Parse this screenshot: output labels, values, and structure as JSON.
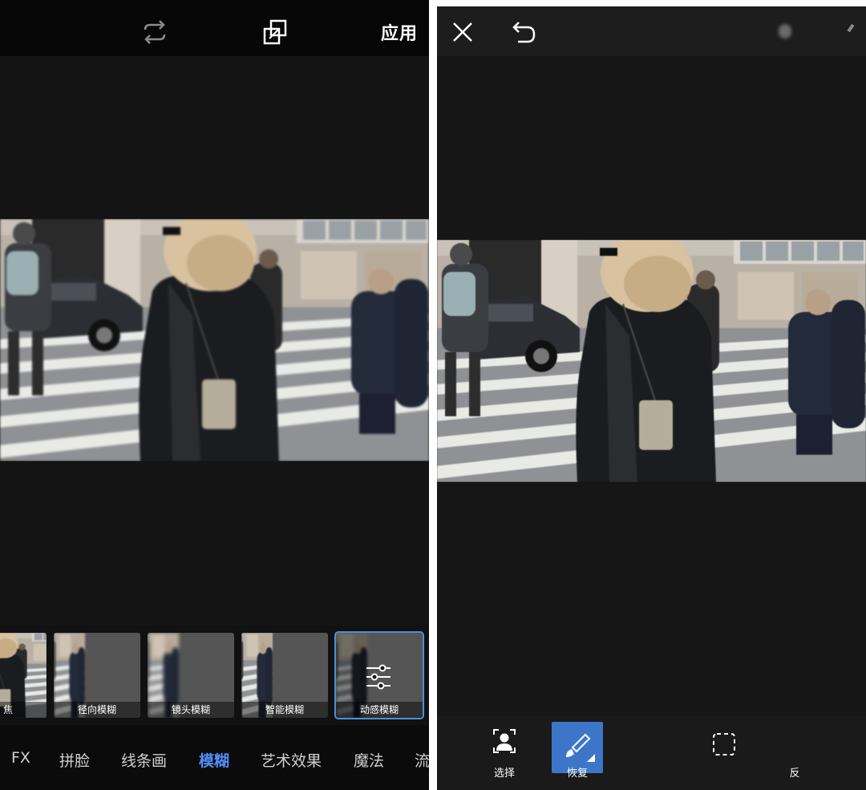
{
  "left": {
    "toolbar": {
      "apply_label": "应用",
      "icons": [
        "repeat-icon",
        "compare-icon"
      ]
    },
    "thumbs": [
      {
        "label": "焦",
        "selected": false
      },
      {
        "label": "径向模糊",
        "selected": false
      },
      {
        "label": "镜头模糊",
        "selected": false
      },
      {
        "label": "智能模糊",
        "selected": false
      },
      {
        "label": "动感模糊",
        "selected": true
      }
    ],
    "categories": [
      {
        "label": "FX",
        "active": false
      },
      {
        "label": "拼脸",
        "active": false
      },
      {
        "label": "线条画",
        "active": false
      },
      {
        "label": "模糊",
        "active": true
      },
      {
        "label": "艺术效果",
        "active": false
      },
      {
        "label": "魔法",
        "active": false
      },
      {
        "label": "流",
        "active": false
      }
    ]
  },
  "right": {
    "toolbar": {
      "icons": [
        "close-icon",
        "undo-icon"
      ]
    },
    "tools": [
      {
        "label": "选择",
        "icon": "person-select-icon",
        "active": false
      },
      {
        "label": "恢复",
        "icon": "brush-icon",
        "active": true
      },
      {
        "label": "",
        "icon": "",
        "active": false
      },
      {
        "label": "",
        "icon": "dashed-square-icon",
        "active": false
      },
      {
        "label": "反",
        "icon": "",
        "active": false
      }
    ]
  },
  "colors": {
    "accent": "#4f8ff7",
    "active_tool": "#3d76c9",
    "background": "#131313"
  }
}
